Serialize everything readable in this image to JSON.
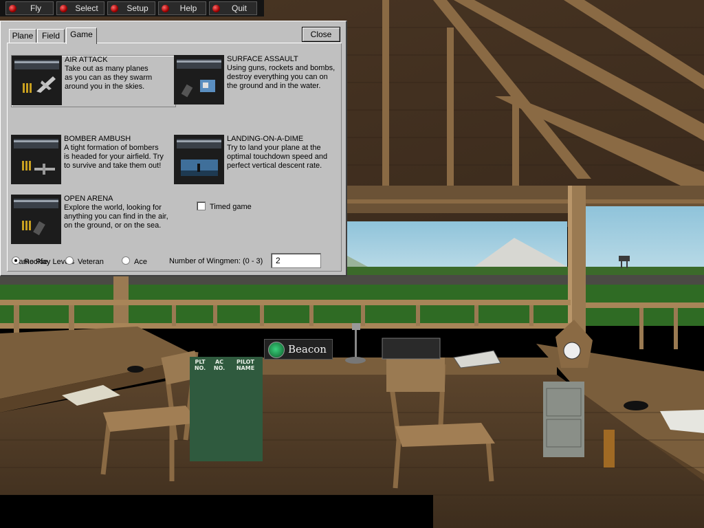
{
  "menu": {
    "items": [
      {
        "label": "Fly"
      },
      {
        "label": "Select"
      },
      {
        "label": "Setup"
      },
      {
        "label": "Help"
      },
      {
        "label": "Quit"
      }
    ]
  },
  "dialog": {
    "tabs": [
      {
        "label": "Plane"
      },
      {
        "label": "Field"
      },
      {
        "label": "Game",
        "active": true
      }
    ],
    "close_label": "Close",
    "modes": [
      {
        "title": "AIR ATTACK",
        "desc": "Take out as many planes\nas you can as they swarm\naround you in the skies.",
        "selected": true,
        "icon": "air-attack-icon"
      },
      {
        "title": "SURFACE ASSAULT",
        "desc": "Using guns, rockets and bombs,\ndestroy everything you can on\nthe ground and in the water.",
        "icon": "surface-assault-icon"
      },
      {
        "title": "BOMBER AMBUSH",
        "desc": "A tight formation of bombers\nis headed for your airfield.  Try\nto survive and take them out!",
        "icon": "bomber-ambush-icon"
      },
      {
        "title": "LANDING-ON-A-DIME",
        "desc": "Try to land your plane at the\noptimal touchdown speed and\nperfect vertical descent rate.",
        "icon": "landing-icon"
      },
      {
        "title": "OPEN ARENA",
        "desc": "Explore the world, looking for\nanything you can find in the air,\non the ground, or on the sea.",
        "icon": "open-arena-icon"
      }
    ],
    "timed_label": "Timed game",
    "timed_checked": false,
    "levels_label": "Game Play Levels",
    "levels": [
      {
        "label": "Rookie",
        "selected": true
      },
      {
        "label": "Veteran",
        "selected": false
      },
      {
        "label": "Ace",
        "selected": false
      }
    ],
    "wingmen_label": "Number of Wingmen: (0 - 3)",
    "wingmen_value": "2"
  },
  "scene": {
    "beacon_label": "Beacon",
    "board_headers": [
      "PLT\nNO.",
      "AC\nNO.",
      "PILOT\nNAME"
    ]
  }
}
